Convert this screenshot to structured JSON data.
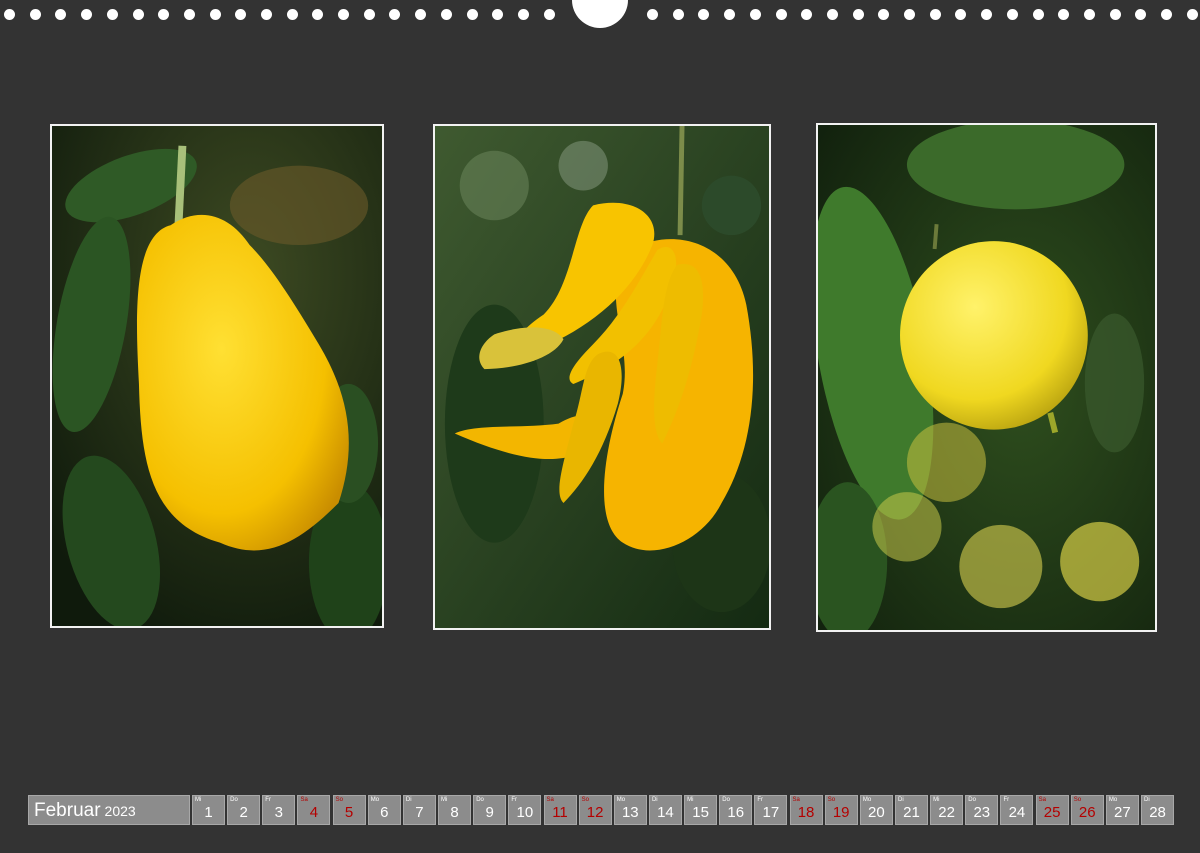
{
  "calendar": {
    "month": "Februar",
    "year": "2023",
    "days": [
      {
        "wd": "Mi",
        "num": "1",
        "weekend": false
      },
      {
        "wd": "Do",
        "num": "2",
        "weekend": false
      },
      {
        "wd": "Fr",
        "num": "3",
        "weekend": false
      },
      {
        "wd": "Sa",
        "num": "4",
        "weekend": true
      },
      {
        "wd": "So",
        "num": "5",
        "weekend": true
      },
      {
        "wd": "Mo",
        "num": "6",
        "weekend": false
      },
      {
        "wd": "Di",
        "num": "7",
        "weekend": false
      },
      {
        "wd": "Mi",
        "num": "8",
        "weekend": false
      },
      {
        "wd": "Do",
        "num": "9",
        "weekend": false
      },
      {
        "wd": "Fr",
        "num": "10",
        "weekend": false
      },
      {
        "wd": "Sa",
        "num": "11",
        "weekend": true
      },
      {
        "wd": "So",
        "num": "12",
        "weekend": true
      },
      {
        "wd": "Mo",
        "num": "13",
        "weekend": false
      },
      {
        "wd": "Di",
        "num": "14",
        "weekend": false
      },
      {
        "wd": "Mi",
        "num": "15",
        "weekend": false
      },
      {
        "wd": "Do",
        "num": "16",
        "weekend": false
      },
      {
        "wd": "Fr",
        "num": "17",
        "weekend": false
      },
      {
        "wd": "Sa",
        "num": "18",
        "weekend": true
      },
      {
        "wd": "So",
        "num": "19",
        "weekend": true
      },
      {
        "wd": "Mo",
        "num": "20",
        "weekend": false
      },
      {
        "wd": "Di",
        "num": "21",
        "weekend": false
      },
      {
        "wd": "Mi",
        "num": "22",
        "weekend": false
      },
      {
        "wd": "Do",
        "num": "23",
        "weekend": false
      },
      {
        "wd": "Fr",
        "num": "24",
        "weekend": false
      },
      {
        "wd": "Sa",
        "num": "25",
        "weekend": true
      },
      {
        "wd": "So",
        "num": "26",
        "weekend": true
      },
      {
        "wd": "Mo",
        "num": "27",
        "weekend": false
      },
      {
        "wd": "Di",
        "num": "28",
        "weekend": false
      }
    ]
  },
  "colors": {
    "background": "#333333",
    "frame": "#f2f2f2",
    "day_cell": "#8c8c8c",
    "weekend_text": "#b40000"
  }
}
